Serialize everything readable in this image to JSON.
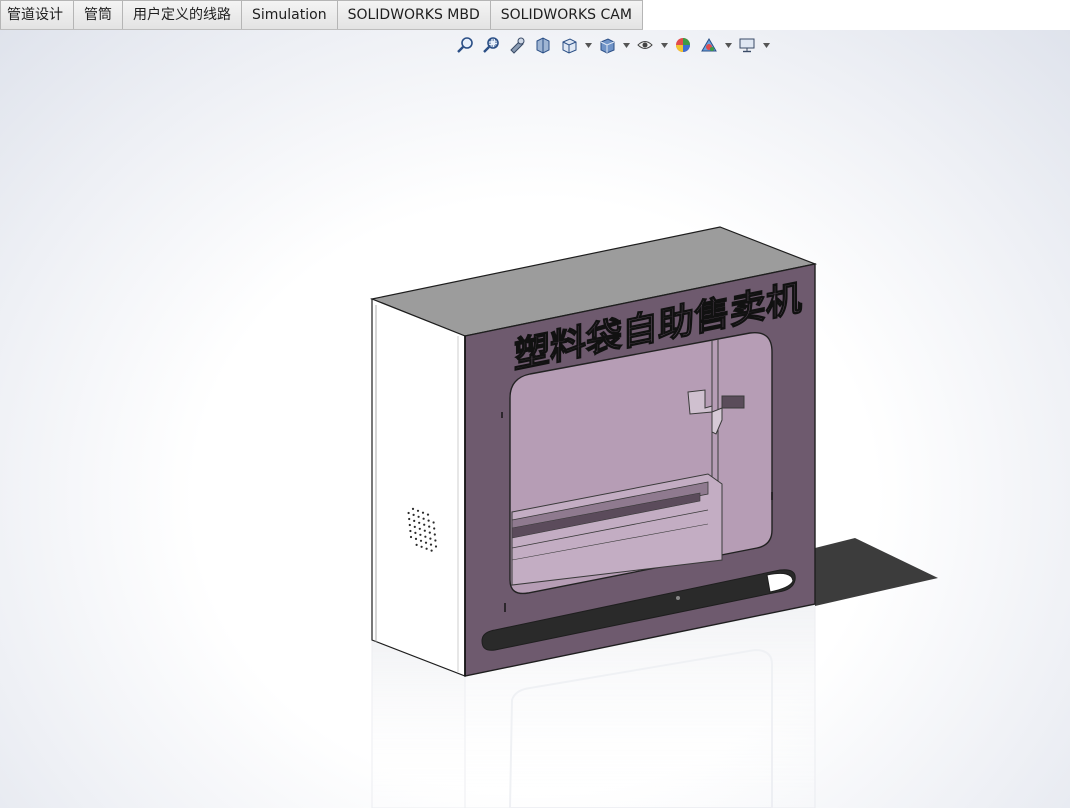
{
  "tabs": [
    {
      "label": "管道设计"
    },
    {
      "label": "管筒"
    },
    {
      "label": "用户定义的线路"
    },
    {
      "label": "Simulation"
    },
    {
      "label": "SOLIDWORKS MBD"
    },
    {
      "label": "SOLIDWORKS CAM"
    }
  ],
  "heads_up_toolbar": {
    "buttons": [
      {
        "icon": "zoom-to-fit-icon"
      },
      {
        "icon": "zoom-to-area-icon"
      },
      {
        "icon": "previous-view-icon"
      },
      {
        "icon": "section-view-icon"
      },
      {
        "icon": "view-orientation-icon"
      },
      {
        "icon": "display-style-icon"
      },
      {
        "icon": "hide-show-items-icon"
      },
      {
        "icon": "edit-appearance-icon"
      },
      {
        "icon": "apply-scene-icon"
      },
      {
        "icon": "view-settings-icon"
      }
    ]
  },
  "model": {
    "sign_text": "塑料袋自助售卖机",
    "colors": {
      "front_panel": "#6e5a6e",
      "window_glass": "#b69db5",
      "body": "#ffffff",
      "top": "#9c9c9c",
      "shadow": "#3c3c3c"
    }
  }
}
